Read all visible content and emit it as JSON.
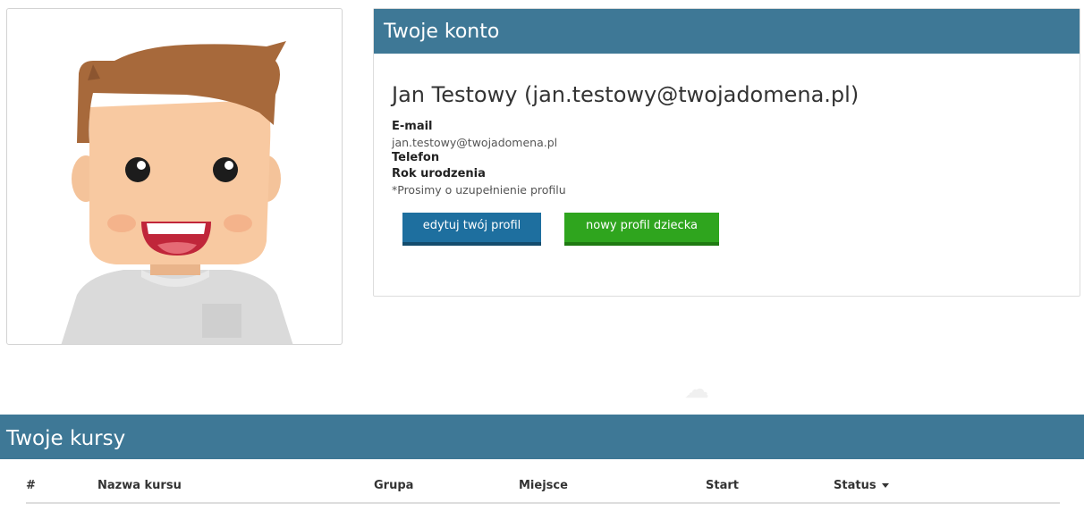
{
  "account": {
    "title": "Twoje konto",
    "user_name": "Jan Testowy (jan.testowy@twojadomena.pl)",
    "email_label": "E-mail",
    "email_value": "jan.testowy@twojadomena.pl",
    "phone_label": "Telefon",
    "birth_year_label": "Rok urodzenia",
    "profile_note": "*Prosimy o uzupełnienie profilu",
    "edit_button": "edytuj twój profil",
    "new_child_button": "nowy profil dziecka"
  },
  "avatar": {
    "icon": "cartoon-avatar"
  },
  "courses": {
    "title": "Twoje kursy",
    "columns": [
      "#",
      "Nazwa kursu",
      "Grupa",
      "Miejsce",
      "Start",
      "Status"
    ],
    "sort_icon": "caret-down-icon",
    "rows": []
  },
  "colors": {
    "header_bg": "#3e7896",
    "edit_button": "#1e6f9f",
    "child_button": "#2fa51e"
  }
}
